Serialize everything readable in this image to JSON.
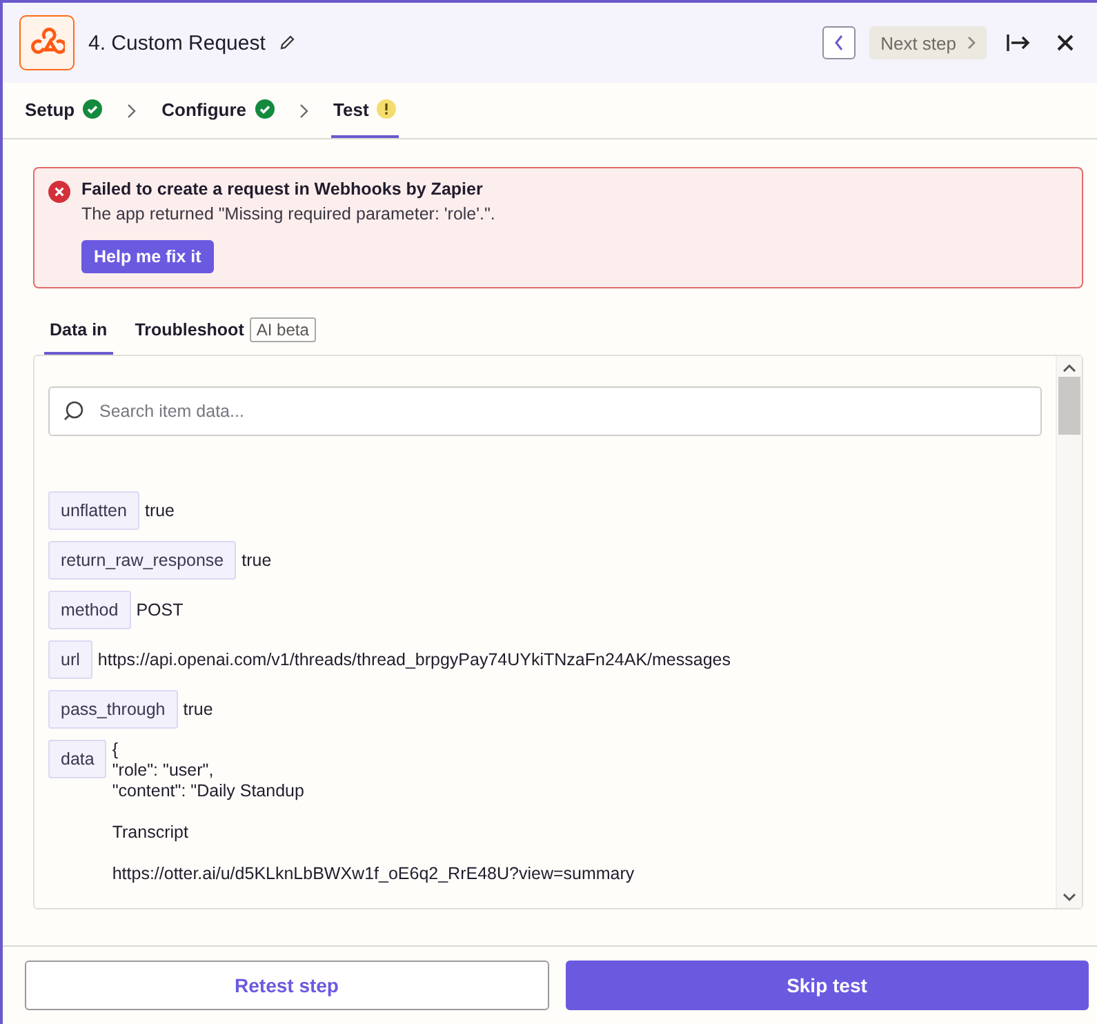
{
  "header": {
    "title": "4. Custom Request",
    "next_label": "Next step"
  },
  "steps": [
    {
      "label": "Setup",
      "kind": "done",
      "selected": false
    },
    {
      "label": "Configure",
      "kind": "done",
      "selected": false
    },
    {
      "label": "Test",
      "kind": "warning",
      "selected": true
    }
  ],
  "alert": {
    "title": "Failed to create a request in Webhooks by Zapier",
    "message": "The app returned \"Missing required parameter: 'role'.\".",
    "action": "Help me fix it"
  },
  "tabs": [
    {
      "label": "Data in",
      "selected": true
    },
    {
      "label": "Troubleshoot",
      "badge": "AI beta",
      "selected": false
    }
  ],
  "search": {
    "placeholder": "Search item data..."
  },
  "fields": [
    {
      "name": "unflatten",
      "value": "true"
    },
    {
      "name": "return_raw_response",
      "value": "true"
    },
    {
      "name": "method",
      "value": "POST"
    },
    {
      "name": "url",
      "value": "https://api.openai.com/v1/threads/thread_brpgyPay74UYkiTNzaFn24AK/messages"
    },
    {
      "name": "pass_through",
      "value": "true"
    },
    {
      "name": "data",
      "value": "{\n\"role\": \"user\",\n\"content\": \"Daily Standup\n\nTranscript\n\nhttps://otter.ai/u/d5KLknLbBWXw1f_oE6q2_RrE48U?view=summary"
    }
  ],
  "footer": {
    "secondary": "Retest step",
    "primary": "Skip test"
  }
}
